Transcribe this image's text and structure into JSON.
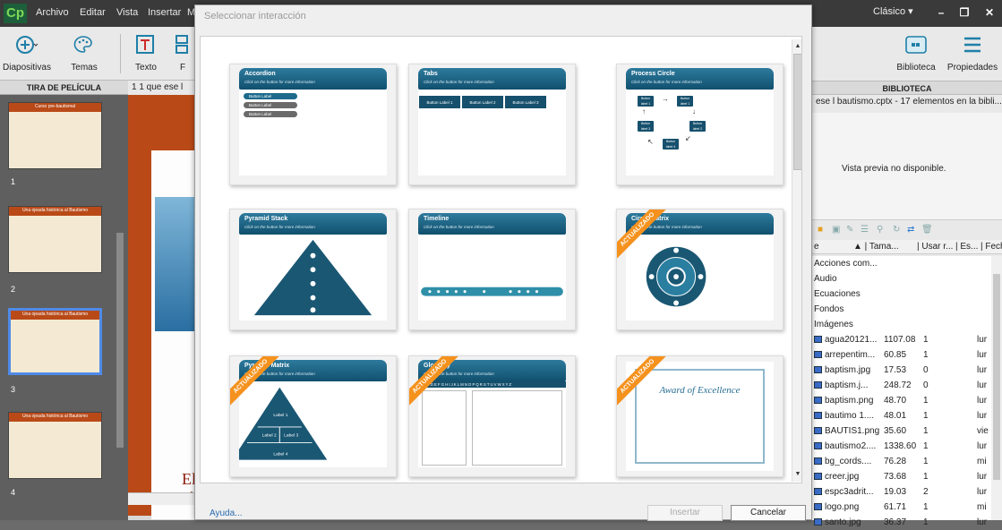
{
  "app": {
    "logo": "Cp",
    "menu": [
      "Archivo",
      "Editar",
      "Vista",
      "Insertar",
      "M"
    ],
    "workspace": "Clásico",
    "window_controls": [
      "–",
      "❐",
      "✕"
    ]
  },
  "toolbar": {
    "buttons": [
      {
        "label": "Diapositivas",
        "icon": "add-slide-icon"
      },
      {
        "label": "Temas",
        "icon": "palette-icon"
      },
      {
        "label": "Texto",
        "icon": "text-icon"
      },
      {
        "label": "F",
        "icon": "shape-icon"
      }
    ],
    "right_buttons": [
      {
        "label": "Biblioteca",
        "icon": "library-icon"
      },
      {
        "label": "Propiedades",
        "icon": "properties-icon"
      }
    ]
  },
  "filmstrip": {
    "header": "TIRA DE PELÍCULA",
    "slides": [
      {
        "num": "1",
        "title": "Curso pre-bautismal"
      },
      {
        "num": "2",
        "title": "Una ojeada histórica al Bautismo"
      },
      {
        "num": "3",
        "title": "Una ojeada histórica al Bautismo"
      },
      {
        "num": "4",
        "title": "Una ojeada histórica al Bautismo"
      }
    ]
  },
  "stage": {
    "header": "1 1 que ese l",
    "text": "El té"
  },
  "dialog": {
    "title": "Seleccionar interacción",
    "help": "Ayuda...",
    "insert_label": "Insertar",
    "cancel_label": "Cancelar",
    "subtitle": "Click on the button for more information",
    "updated_ribbon": "ACTUALIZADO",
    "cards": [
      {
        "name": "Accordion",
        "updated": false,
        "buttons": [
          "Button Label",
          "Button Label",
          "Button Label"
        ]
      },
      {
        "name": "Tabs",
        "updated": false,
        "buttons": [
          "Button Label 1",
          "Button Label 2",
          "Button Label 3"
        ]
      },
      {
        "name": "Process Circle",
        "updated": false,
        "nodes": [
          "Button label 1",
          "Button label 1",
          "Button label 2",
          "Button label 3",
          "Button label 4"
        ]
      },
      {
        "name": "Pyramid Stack",
        "updated": false
      },
      {
        "name": "Timeline",
        "updated": false
      },
      {
        "name": "Circle Matrix",
        "updated": true
      },
      {
        "name": "Pyramid Matrix",
        "updated": true,
        "labels": [
          "Label 1",
          "Label 2",
          "Label 3",
          "Label 4"
        ]
      },
      {
        "name": "Glossary",
        "updated": true,
        "alphabet": "A B C D E F G H I J K L M N O P Q R S T U V W X Y Z"
      },
      {
        "name": "",
        "updated": true,
        "certificate": "Award of Excellence"
      }
    ]
  },
  "library": {
    "header": "BIBLIOTECA",
    "path": "ese l bautismo.cptx - 17 elementos en la bibli...",
    "preview": "Vista previa no disponible.",
    "columns": [
      "e",
      "▲ | Tama...",
      "| Usar r...",
      "| Es...",
      "| Fecha"
    ],
    "folders": [
      "Acciones com...",
      "Audio",
      "Ecuaciones",
      "Fondos",
      "Imágenes"
    ],
    "files": [
      {
        "name": "agua20121...",
        "size": "1107.08",
        "use": "1",
        "date": "lur"
      },
      {
        "name": "arrepentim...",
        "size": "60.85",
        "use": "1",
        "date": "lur"
      },
      {
        "name": "baptism.jpg",
        "size": "17.53",
        "use": "0",
        "date": "lur"
      },
      {
        "name": "baptism.j...",
        "size": "248.72",
        "use": "0",
        "date": "lur"
      },
      {
        "name": "baptism.png",
        "size": "48.70",
        "use": "1",
        "date": "lur"
      },
      {
        "name": "bautimo 1....",
        "size": "48.01",
        "use": "1",
        "date": "lur"
      },
      {
        "name": "BAUTIS1.png",
        "size": "35.60",
        "use": "1",
        "date": "vie"
      },
      {
        "name": "bautismo2....",
        "size": "1338.60",
        "use": "1",
        "date": "lur"
      },
      {
        "name": "bg_cords....",
        "size": "76.28",
        "use": "1",
        "date": "mi"
      },
      {
        "name": "creer.jpg",
        "size": "73.68",
        "use": "1",
        "date": "lur"
      },
      {
        "name": "espc3adrit...",
        "size": "19.03",
        "use": "2",
        "date": "lur"
      },
      {
        "name": "logo.png",
        "size": "61.71",
        "use": "1",
        "date": "mi"
      },
      {
        "name": "santo.jpg",
        "size": "36.37",
        "use": "1",
        "date": "lur"
      }
    ]
  }
}
